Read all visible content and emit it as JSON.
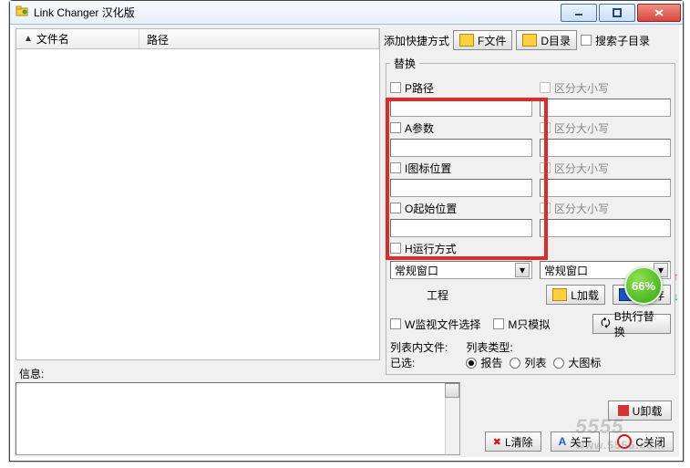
{
  "window": {
    "title": "Link Changer 汉化版"
  },
  "filelist": {
    "col_file": "文件名",
    "col_path": "路径"
  },
  "addbar": {
    "label": "添加快捷方式",
    "btn_file": "F文件",
    "btn_dir": "D目录",
    "cb_subdir": "搜索子目录"
  },
  "replace": {
    "legend": "替换",
    "path_cb": "P路径",
    "case1": "区分大小写",
    "args_cb": "A参数",
    "case2": "区分大小写",
    "icon_cb": "I图标位置",
    "case3": "区分大小写",
    "start_cb": "O起始位置",
    "case4": "区分大小写",
    "run_cb": "H运行方式",
    "sel1": "常规窗口",
    "sel2": "常规窗口",
    "btn_eng": "工程",
    "btn_load": "L加载",
    "btn_save": "S保存",
    "cb_watch": "W监视文件选择",
    "cb_sim": "M只模拟",
    "btn_exec": "B执行替换",
    "listfiles_label": "列表内文件:",
    "listfiles_sel": "已选:",
    "listtype_label": "列表类型:",
    "r_report": "报告",
    "r_list": "列表",
    "r_bigicon": "大图标"
  },
  "bottom": {
    "info": "信息:",
    "btn_unload": "U卸载",
    "btn_clear": "L清除",
    "btn_about": "关于",
    "btn_close": "C关闭"
  },
  "badge": "66%",
  "watermark": {
    "main": "5555",
    "sub": "www.5555.com"
  }
}
